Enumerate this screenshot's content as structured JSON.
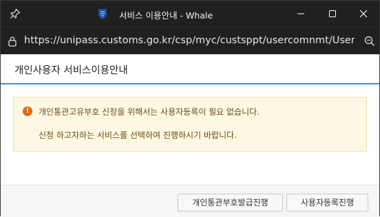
{
  "window": {
    "title": "서비스 이용안내 - Whale",
    "url": "https://unipass.customs.go.kr/csp/myc/custsppt/usercomnmt/UserMtCtr/op"
  },
  "dialog": {
    "title": "개인사용자 서비스이용안내",
    "notice": {
      "line1": "개인통관고유부호 신청을 위해서는 사용자등록이 필요 없습니다.",
      "line2": "신청 하고자하는 서비스를 선택하여 진행하시기 바랍니다."
    },
    "buttons": {
      "issue_label": "개인통관부호발급진행",
      "register_label": "사용자등록진행"
    }
  },
  "colors": {
    "titlebar": "#202020",
    "header_border": "#4a90c8",
    "notice_bg": "#fcf8e3",
    "warning_icon": "#e06a10"
  }
}
